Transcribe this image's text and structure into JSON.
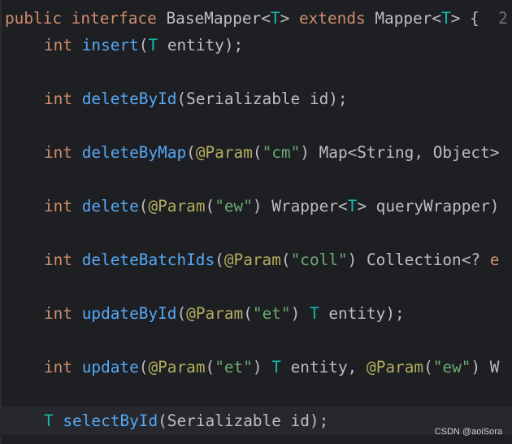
{
  "editor": {
    "lines": [
      {
        "tokens": [
          {
            "text": "public",
            "kind": "kw"
          },
          {
            "text": " ",
            "kind": "plain"
          },
          {
            "text": "interface",
            "kind": "kw"
          },
          {
            "text": " BaseMapper<",
            "kind": "plain"
          },
          {
            "text": "T",
            "kind": "tp"
          },
          {
            "text": "> ",
            "kind": "plain"
          },
          {
            "text": "extends",
            "kind": "kw"
          },
          {
            "text": " Mapper<",
            "kind": "plain"
          },
          {
            "text": "T",
            "kind": "tp"
          },
          {
            "text": "> {  ",
            "kind": "plain"
          },
          {
            "text": "2",
            "kind": "hint"
          }
        ]
      },
      {
        "tokens": [
          {
            "text": "int",
            "kind": "kw"
          },
          {
            "text": " ",
            "kind": "plain"
          },
          {
            "text": "insert",
            "kind": "fn"
          },
          {
            "text": "(",
            "kind": "plain"
          },
          {
            "text": "T",
            "kind": "tp"
          },
          {
            "text": " entity);",
            "kind": "plain"
          }
        ]
      },
      {
        "tokens": [
          {
            "text": "int",
            "kind": "kw"
          },
          {
            "text": " ",
            "kind": "plain"
          },
          {
            "text": "deleteById",
            "kind": "fn"
          },
          {
            "text": "(Serializable id);",
            "kind": "plain"
          }
        ]
      },
      {
        "tokens": [
          {
            "text": "int",
            "kind": "kw"
          },
          {
            "text": " ",
            "kind": "plain"
          },
          {
            "text": "deleteByMap",
            "kind": "fn"
          },
          {
            "text": "(",
            "kind": "plain"
          },
          {
            "text": "@Param",
            "kind": "ann"
          },
          {
            "text": "(",
            "kind": "plain"
          },
          {
            "text": "\"cm\"",
            "kind": "str"
          },
          {
            "text": ") Map<String, Object>",
            "kind": "plain"
          }
        ]
      },
      {
        "tokens": [
          {
            "text": "int",
            "kind": "kw"
          },
          {
            "text": " ",
            "kind": "plain"
          },
          {
            "text": "delete",
            "kind": "fn"
          },
          {
            "text": "(",
            "kind": "plain"
          },
          {
            "text": "@Param",
            "kind": "ann"
          },
          {
            "text": "(",
            "kind": "plain"
          },
          {
            "text": "\"ew\"",
            "kind": "str"
          },
          {
            "text": ") Wrapper<",
            "kind": "plain"
          },
          {
            "text": "T",
            "kind": "tp"
          },
          {
            "text": "> queryWrapper)",
            "kind": "plain"
          }
        ]
      },
      {
        "tokens": [
          {
            "text": "int",
            "kind": "kw"
          },
          {
            "text": " ",
            "kind": "plain"
          },
          {
            "text": "deleteBatchIds",
            "kind": "fn"
          },
          {
            "text": "(",
            "kind": "plain"
          },
          {
            "text": "@Param",
            "kind": "ann"
          },
          {
            "text": "(",
            "kind": "plain"
          },
          {
            "text": "\"coll\"",
            "kind": "str"
          },
          {
            "text": ") Collection<? ",
            "kind": "plain"
          },
          {
            "text": "e",
            "kind": "kw"
          }
        ]
      },
      {
        "tokens": [
          {
            "text": "int",
            "kind": "kw"
          },
          {
            "text": " ",
            "kind": "plain"
          },
          {
            "text": "updateById",
            "kind": "fn"
          },
          {
            "text": "(",
            "kind": "plain"
          },
          {
            "text": "@Param",
            "kind": "ann"
          },
          {
            "text": "(",
            "kind": "plain"
          },
          {
            "text": "\"et\"",
            "kind": "str"
          },
          {
            "text": ") ",
            "kind": "plain"
          },
          {
            "text": "T",
            "kind": "tp"
          },
          {
            "text": " entity);",
            "kind": "plain"
          }
        ]
      },
      {
        "tokens": [
          {
            "text": "int",
            "kind": "kw"
          },
          {
            "text": " ",
            "kind": "plain"
          },
          {
            "text": "update",
            "kind": "fn"
          },
          {
            "text": "(",
            "kind": "plain"
          },
          {
            "text": "@Param",
            "kind": "ann"
          },
          {
            "text": "(",
            "kind": "plain"
          },
          {
            "text": "\"et\"",
            "kind": "str"
          },
          {
            "text": ") ",
            "kind": "plain"
          },
          {
            "text": "T",
            "kind": "tp"
          },
          {
            "text": " entity, ",
            "kind": "plain"
          },
          {
            "text": "@Param",
            "kind": "ann"
          },
          {
            "text": "(",
            "kind": "plain"
          },
          {
            "text": "\"ew\"",
            "kind": "str"
          },
          {
            "text": ") W",
            "kind": "plain"
          }
        ]
      },
      {
        "tokens": [
          {
            "text": "T",
            "kind": "tp"
          },
          {
            "text": " ",
            "kind": "plain"
          },
          {
            "text": "selectById",
            "kind": "fn"
          },
          {
            "text": "(Serializable id);",
            "kind": "plain"
          }
        ]
      }
    ]
  },
  "watermark": "CSDN @aoiSora",
  "colors": {
    "background": "#1e1f22",
    "current_line": "#26282e",
    "keyword": "#cf8e6d",
    "type_parameter": "#16baac",
    "method_name": "#56a8f5",
    "annotation": "#b3ae60",
    "string": "#6aab73",
    "plain_text": "#bcbec4"
  }
}
